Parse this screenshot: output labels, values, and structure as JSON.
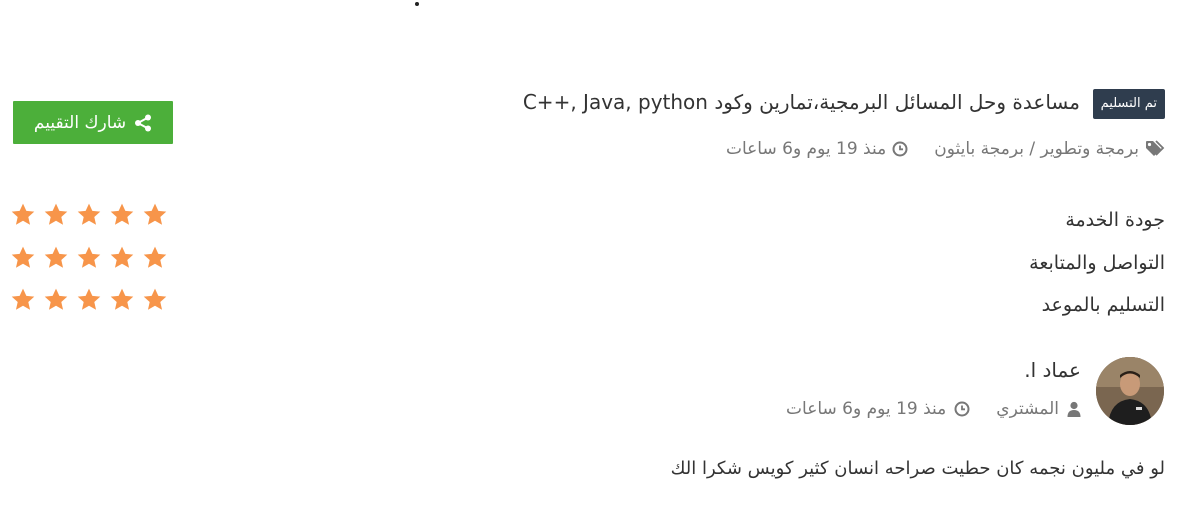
{
  "project": {
    "status_badge": "تم التسليم",
    "title": "مساعدة وحل المسائل البرمجية،تمارين وكود C++, Java, python",
    "category": "برمجة وتطوير / برمجة بايثون",
    "time_ago": "منذ 19 يوم و6 ساعات"
  },
  "share_button": {
    "label": "شارك التقييم"
  },
  "ratings": [
    {
      "label": "جودة الخدمة",
      "stars": 5
    },
    {
      "label": "التواصل والمتابعة",
      "stars": 5
    },
    {
      "label": "التسليم بالموعد",
      "stars": 5
    }
  ],
  "reviewer": {
    "name": "عماد ا.",
    "role": "المشتري",
    "time_ago": "منذ 19 يوم و6 ساعات"
  },
  "comment": "لو في مليون نجمه كان حطيت صراحه انسان كثير كويس شكرا الك",
  "colors": {
    "badge_bg": "#2f3d4e",
    "share_green": "#4caf3a",
    "star_orange": "#f7954a",
    "meta_grey": "#777777"
  },
  "icons": {
    "tags": "tags-icon",
    "clock": "clock-icon",
    "user": "user-icon",
    "share": "share-icon",
    "star": "star-icon"
  }
}
